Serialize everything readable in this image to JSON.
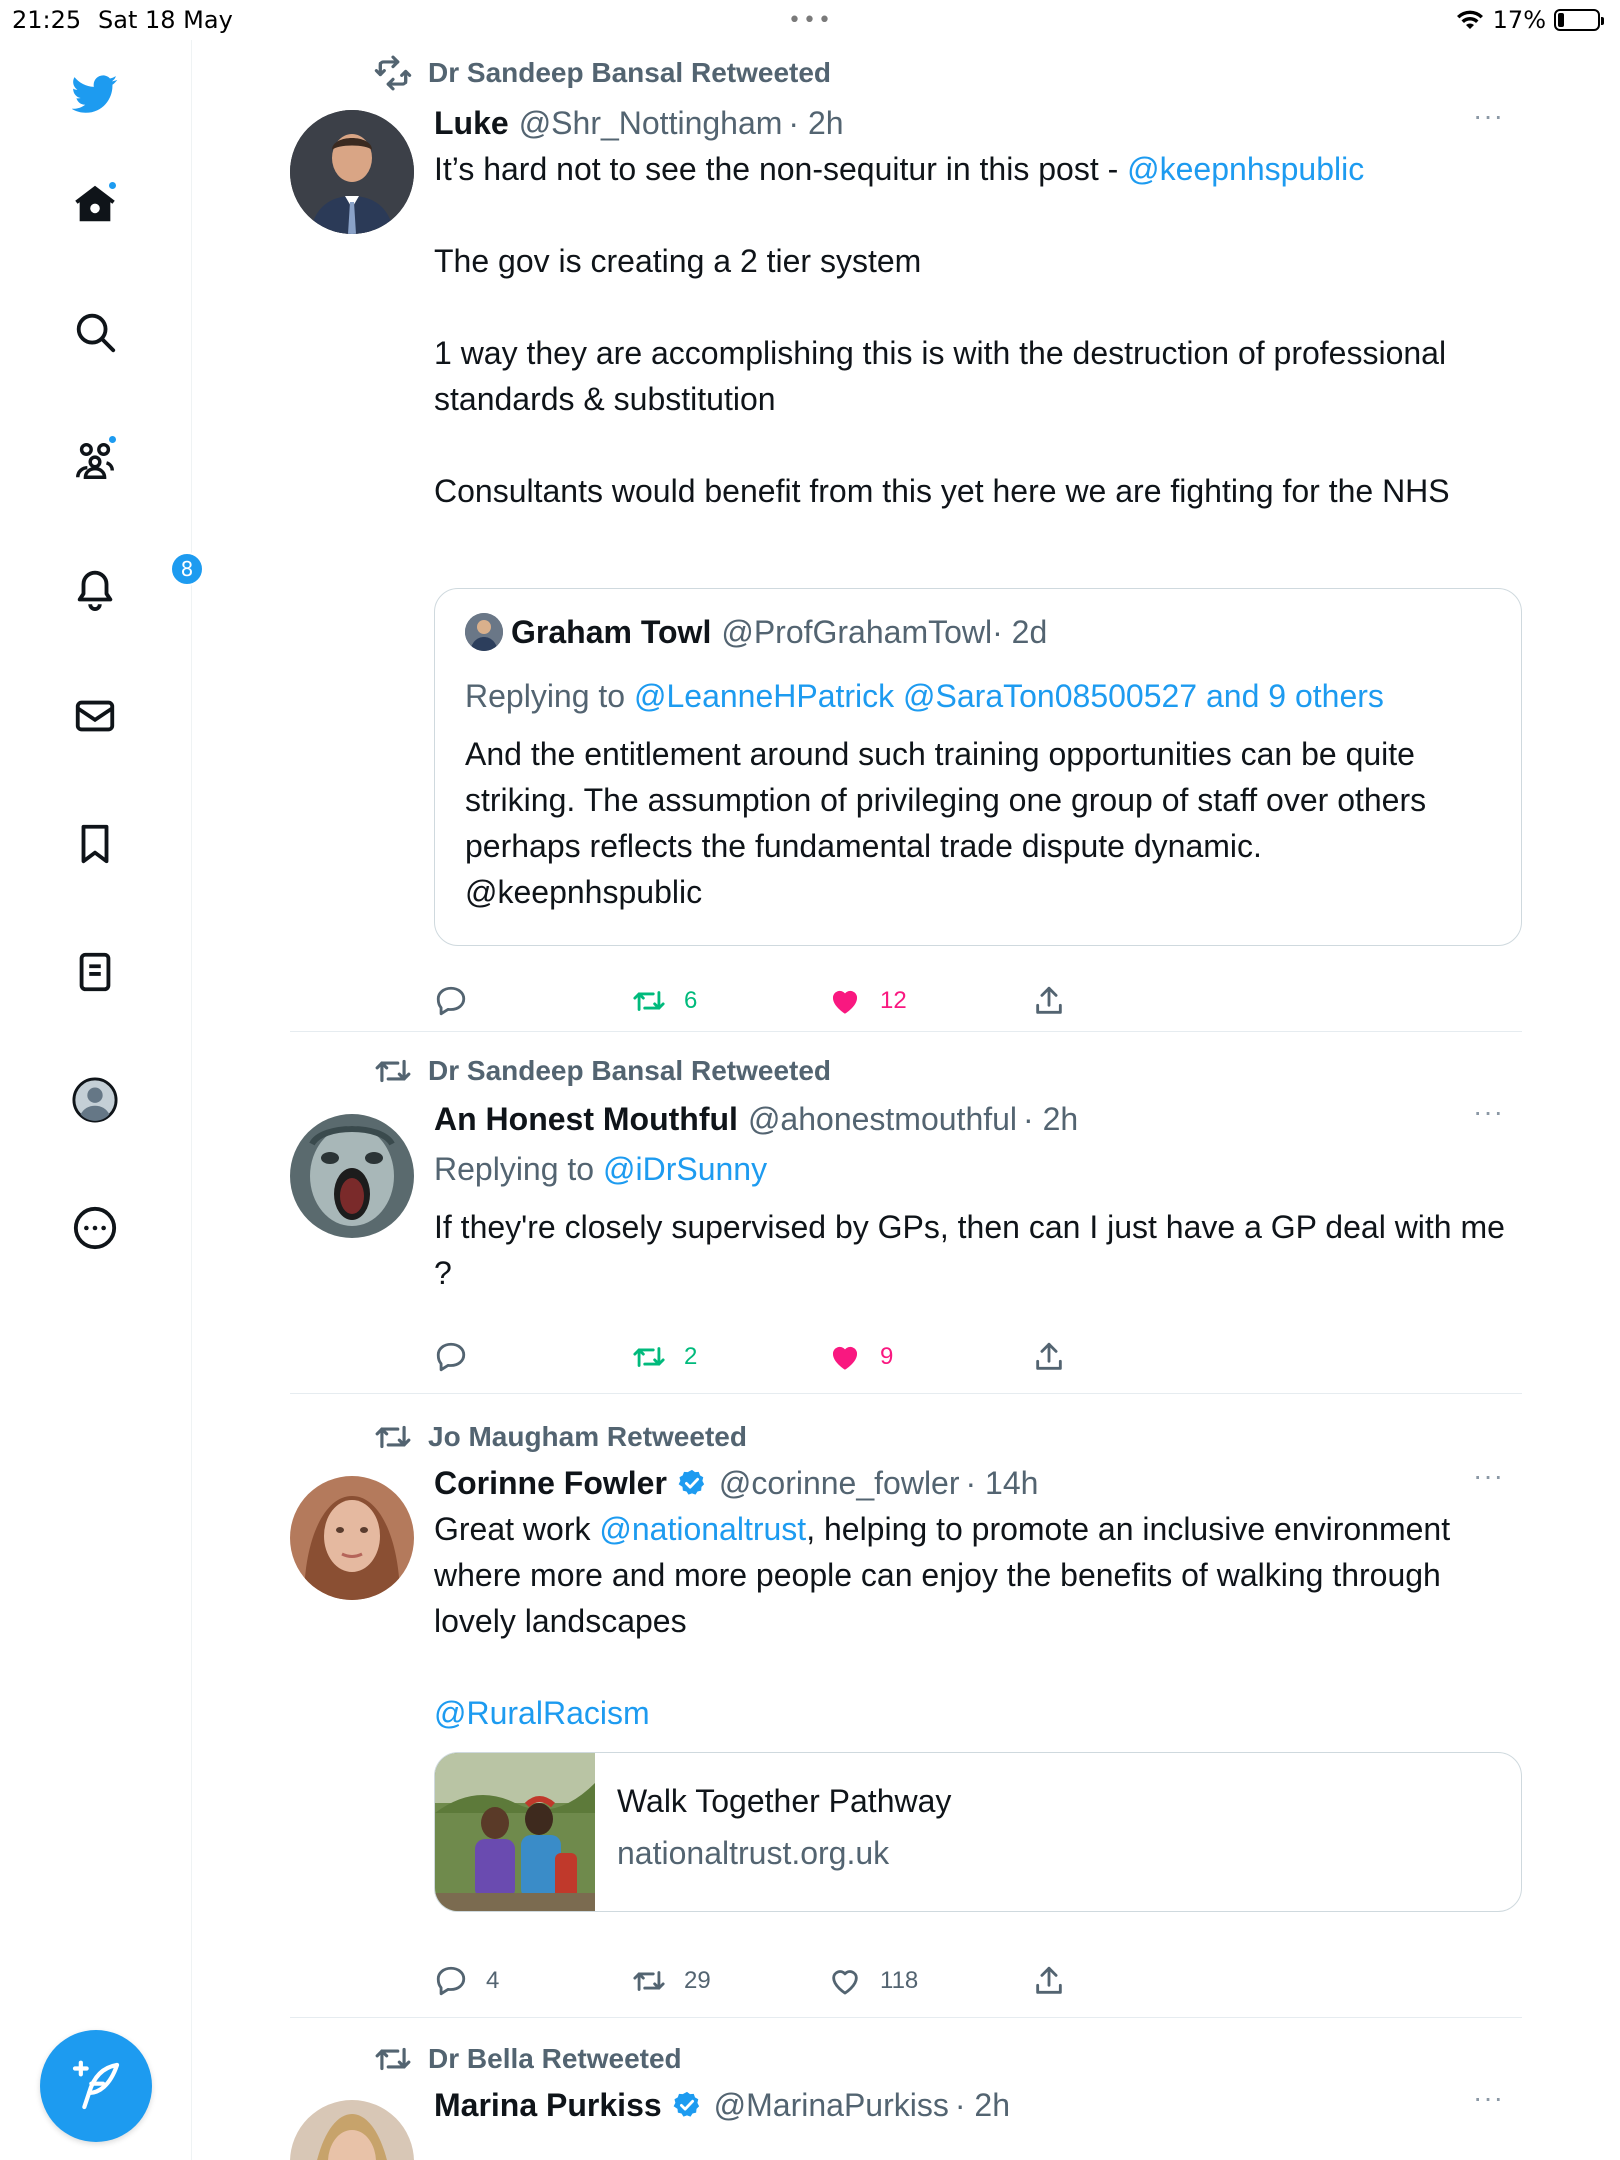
{
  "status_bar": {
    "time": "21:25",
    "date": "Sat 18 May",
    "battery": "17%",
    "battery_level": 0.17
  },
  "colors": {
    "accent": "#1d9bf0",
    "retweet_green": "#00ba7c",
    "like_pink": "#f91880",
    "secondary_text": "#536471"
  },
  "sidebar": {
    "items": [
      {
        "icon": "twitter-bird-icon"
      },
      {
        "icon": "home-icon"
      },
      {
        "icon": "search-icon"
      },
      {
        "icon": "communities-icon"
      },
      {
        "icon": "bell-icon",
        "badge": "8"
      },
      {
        "icon": "mail-icon"
      },
      {
        "icon": "bookmark-icon"
      },
      {
        "icon": "list-icon"
      },
      {
        "icon": "profile-icon"
      },
      {
        "icon": "more-circle-icon"
      }
    ],
    "compose": {
      "icon": "feather-plus-icon"
    }
  },
  "tweets": [
    {
      "retweeted_by": "Dr Sandeep Bansal Retweeted",
      "name": "Luke",
      "handle": "@Shr_Nottingham",
      "time": "· 2h",
      "more": "···",
      "text_line1_pre": "It’s hard not to see the non-sequitur in this post - ",
      "text_line1_link": "@keepnhspublic",
      "text_para2": "The gov is creating a 2 tier system",
      "text_para3": "1 way they are accomplishing this is with the destruction of professional standards & substitution",
      "text_para4": "Consultants would benefit from this yet here we are fighting for the NHS",
      "quote": {
        "name": "Graham Towl",
        "handle": "@ProfGrahamTowl",
        "time": "· 2d",
        "replying_label": "Replying to ",
        "replying_links": "@LeanneHPatrick @SaraTon08500527 and 9 others",
        "text": "And the entitlement around such training opportunities can be quite striking. The assumption of privileging one group of staff over others perhaps reflects the fundamental trade dispute dynamic. @keepnhspublic"
      },
      "replies": "",
      "retweets": "6",
      "likes": "12"
    },
    {
      "retweeted_by": "Dr Sandeep Bansal Retweeted",
      "name": "An Honest Mouthful",
      "handle": "@ahonestmouthful",
      "time": "· 2h",
      "more": "···",
      "replying_label": "Replying to ",
      "replying_link": "@iDrSunny",
      "text": "If they're closely supervised by GPs, then can I just have a GP deal with me ?",
      "replies": "",
      "retweets": "2",
      "likes": "9"
    },
    {
      "retweeted_by": "Jo Maugham Retweeted",
      "name": "Corinne Fowler",
      "handle": "@corinne_fowler",
      "time": "· 14h",
      "more": "···",
      "text_pre": "Great work ",
      "text_link": "@nationaltrust",
      "text_post": ", helping to promote an inclusive environment where more and more people can enjoy the benefits of walking through lovely landscapes",
      "text_link2": "@RuralRacism",
      "card": {
        "title": "Walk Together Pathway",
        "domain": "nationaltrust.org.uk"
      },
      "replies": "4",
      "retweets": "29",
      "likes": "118"
    },
    {
      "retweeted_by": "Dr Bella Retweeted",
      "name": "Marina Purkiss",
      "handle": "@MarinaPurkiss",
      "time": "· 2h",
      "more": "···"
    }
  ]
}
